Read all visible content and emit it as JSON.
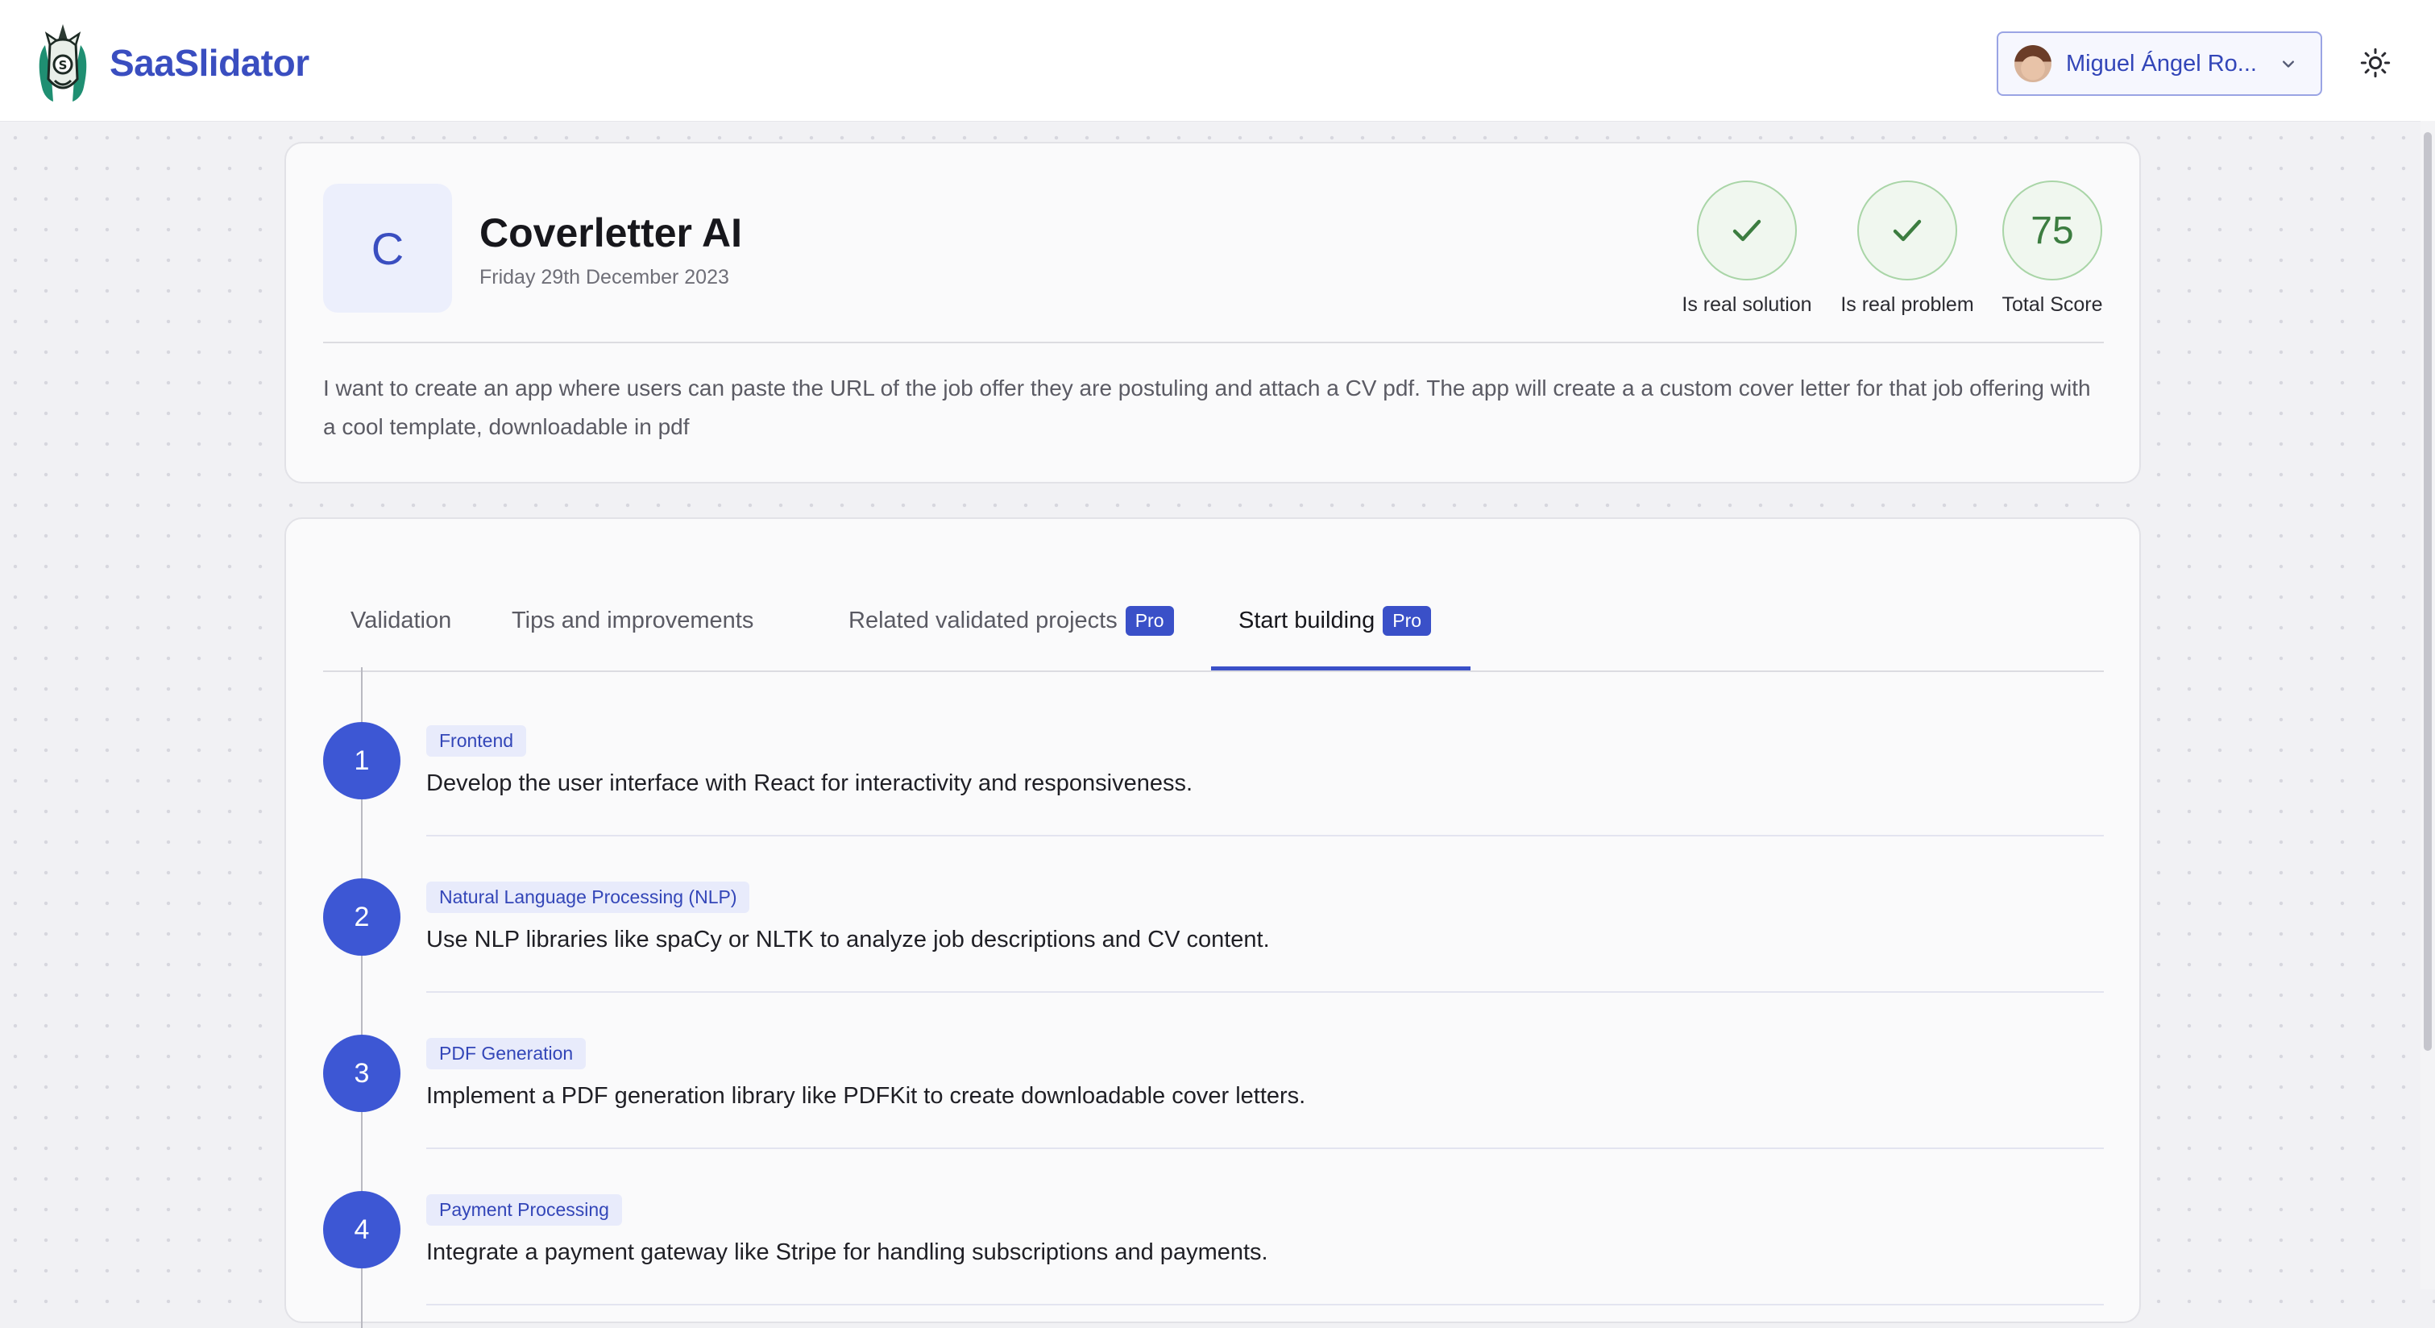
{
  "header": {
    "brand_name": "SaaSlidator",
    "user_name": "Miguel Ángel Ro...",
    "icons": {
      "logo": "unicorn-logo-icon",
      "avatar": "user-avatar",
      "dropdown": "chevron-down-icon",
      "theme": "sun-icon"
    }
  },
  "project": {
    "initial": "C",
    "title": "Coverletter AI",
    "date": "Friday 29th December 2023",
    "description": "I want to create an app where users can paste the URL of the job offer they are postuling and attach a CV pdf. The app will create a a custom cover letter for that job offering with a cool template, downloadable in pdf",
    "metrics": [
      {
        "label": "Is real solution",
        "value": "✓",
        "icon": "check-icon"
      },
      {
        "label": "Is real problem",
        "value": "✓",
        "icon": "check-icon"
      },
      {
        "label": "Total Score",
        "value": "75"
      }
    ]
  },
  "tabs": [
    {
      "label": "Validation",
      "badge": ""
    },
    {
      "label": "Tips and improvements",
      "badge": ""
    },
    {
      "label": "Related validated projects",
      "badge": "Pro"
    },
    {
      "label": "Start building",
      "badge": "Pro",
      "active": true
    }
  ],
  "steps": [
    {
      "number": "1",
      "tag": "Frontend",
      "text": "Develop the user interface with React for interactivity and responsiveness."
    },
    {
      "number": "2",
      "tag": "Natural Language Processing (NLP)",
      "text": "Use NLP libraries like spaCy or NLTK to analyze job descriptions and CV content."
    },
    {
      "number": "3",
      "tag": "PDF Generation",
      "text": "Implement a PDF generation library like PDFKit to create downloadable cover letters."
    },
    {
      "number": "4",
      "tag": "Payment Processing",
      "text": "Integrate a payment gateway like Stripe for handling subscriptions and payments."
    }
  ],
  "colors": {
    "brand": "#3a4ec0",
    "accent": "#3d57d4",
    "success": "#3c7d40",
    "background": "#f1f1f4"
  }
}
